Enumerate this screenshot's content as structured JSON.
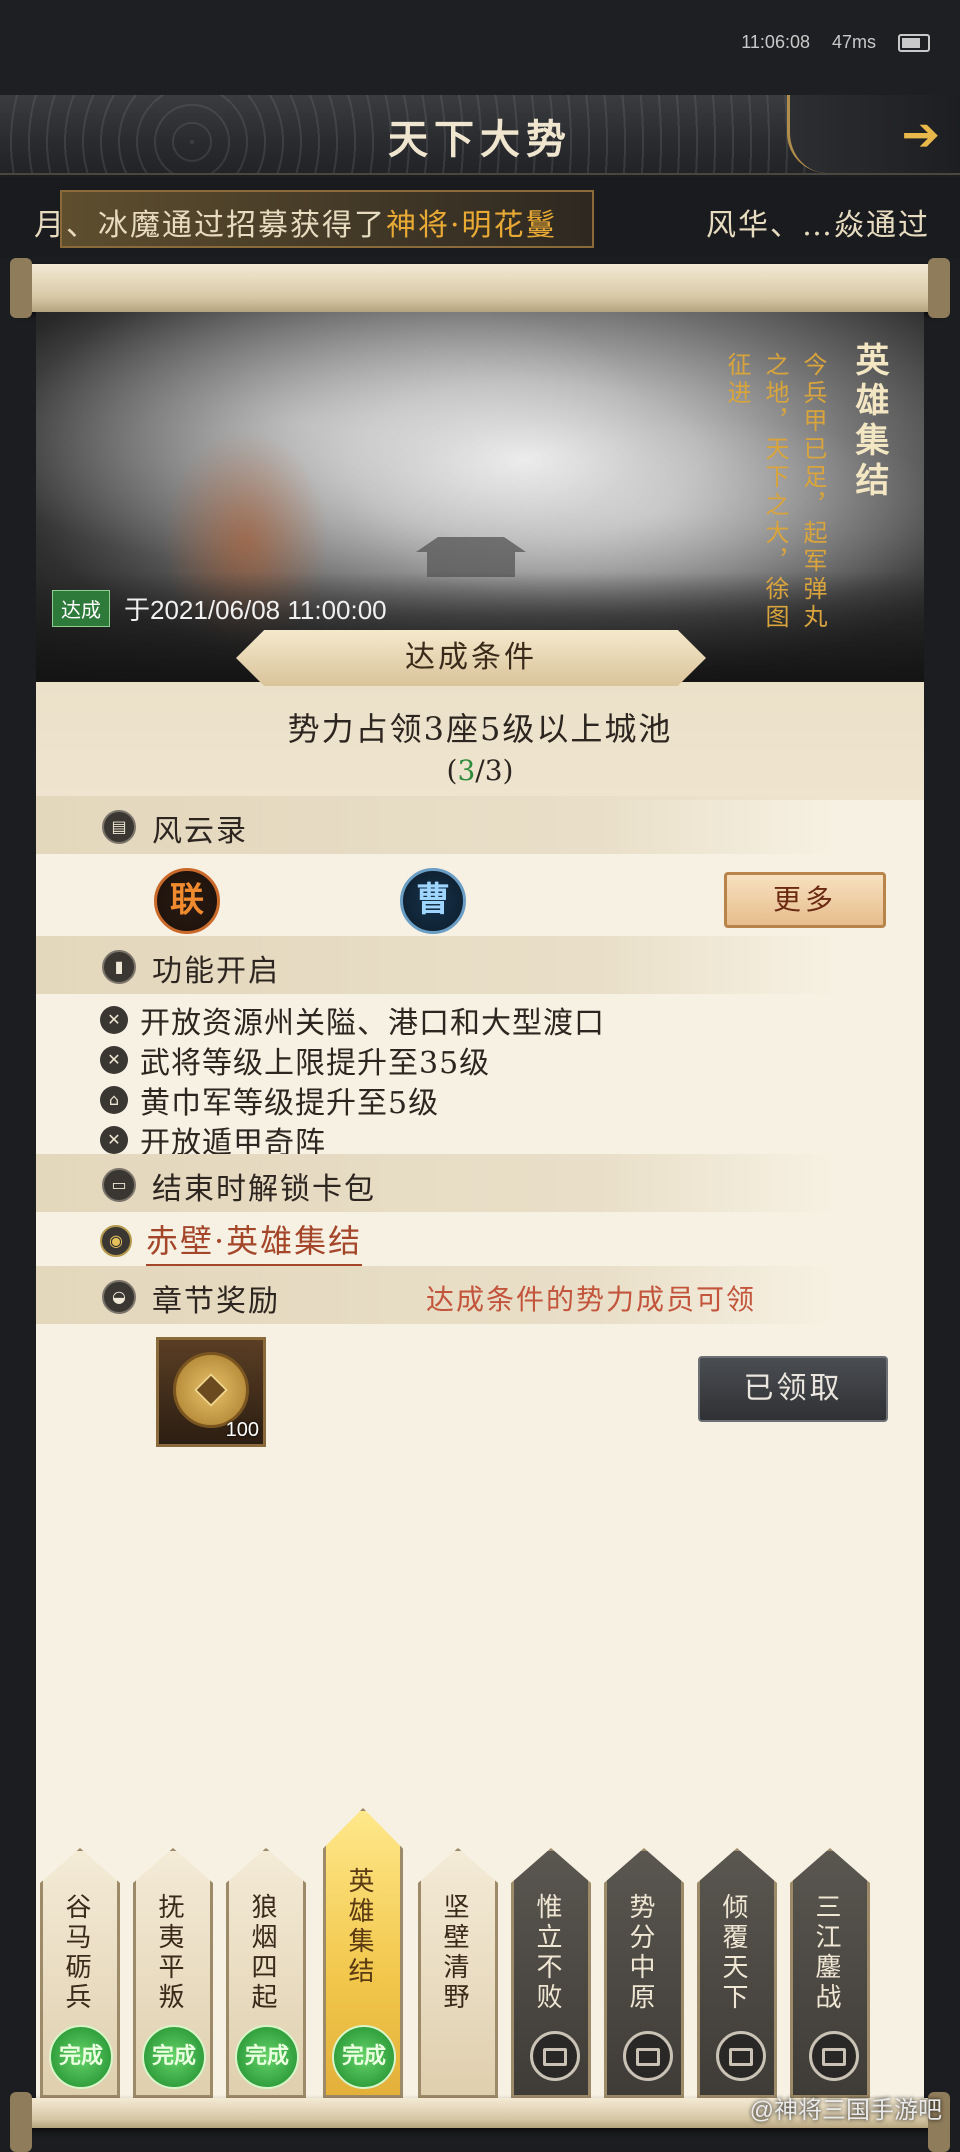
{
  "status_bar": {
    "time": "11:06:08",
    "latency": "47ms"
  },
  "header": {
    "title": "天下大势",
    "back_icon": "arrow-right-icon"
  },
  "ticker": {
    "left_prefix": "月、冰魔通过招募获得了",
    "left_highlight": "神将·明花鬘",
    "right": "风华、…焱通过"
  },
  "chapter": {
    "title": "英雄集结",
    "verse": "今兵甲已足，起军弹丸之地，天下之大，徐图征进",
    "achieved_badge": "达成",
    "achieved_time": "于2021/06/08 11:00:00"
  },
  "condition": {
    "plate_label": "达成条件",
    "text": "势力占领3座5级以上城池",
    "progress_open": "(",
    "progress_current": "3",
    "progress_rest": "/3)"
  },
  "fengyun": {
    "label": "风云录",
    "factions": [
      "联",
      "曹"
    ],
    "more_label": "更多"
  },
  "features": {
    "label": "功能开启",
    "items": [
      "开放资源州关隘、港口和大型渡口",
      "武将等级上限提升至35级",
      "黄巾军等级提升至5级",
      "开放遁甲奇阵"
    ]
  },
  "card_pack": {
    "label": "结束时解锁卡包",
    "link": "赤壁·英雄集结"
  },
  "reward": {
    "label": "章节奖励",
    "note": "达成条件的势力成员可领",
    "item_qty": "100",
    "claimed_label": "已领取"
  },
  "tabs": [
    {
      "label": "谷马砺兵",
      "state": "done",
      "badge": "完成"
    },
    {
      "label": "抚夷平叛",
      "state": "done",
      "badge": "完成"
    },
    {
      "label": "狼烟四起",
      "state": "done",
      "badge": "完成"
    },
    {
      "label": "英雄集结",
      "state": "active",
      "badge": "完成"
    },
    {
      "label": "坚壁清野",
      "state": "open",
      "badge": ""
    },
    {
      "label": "惟立不败",
      "state": "locked",
      "badge": ""
    },
    {
      "label": "势分中原",
      "state": "locked",
      "badge": ""
    },
    {
      "label": "倾覆天下",
      "state": "locked",
      "badge": ""
    },
    {
      "label": "三江鏖战",
      "state": "locked",
      "badge": ""
    }
  ],
  "watermark": "@神将三国手游吧"
}
